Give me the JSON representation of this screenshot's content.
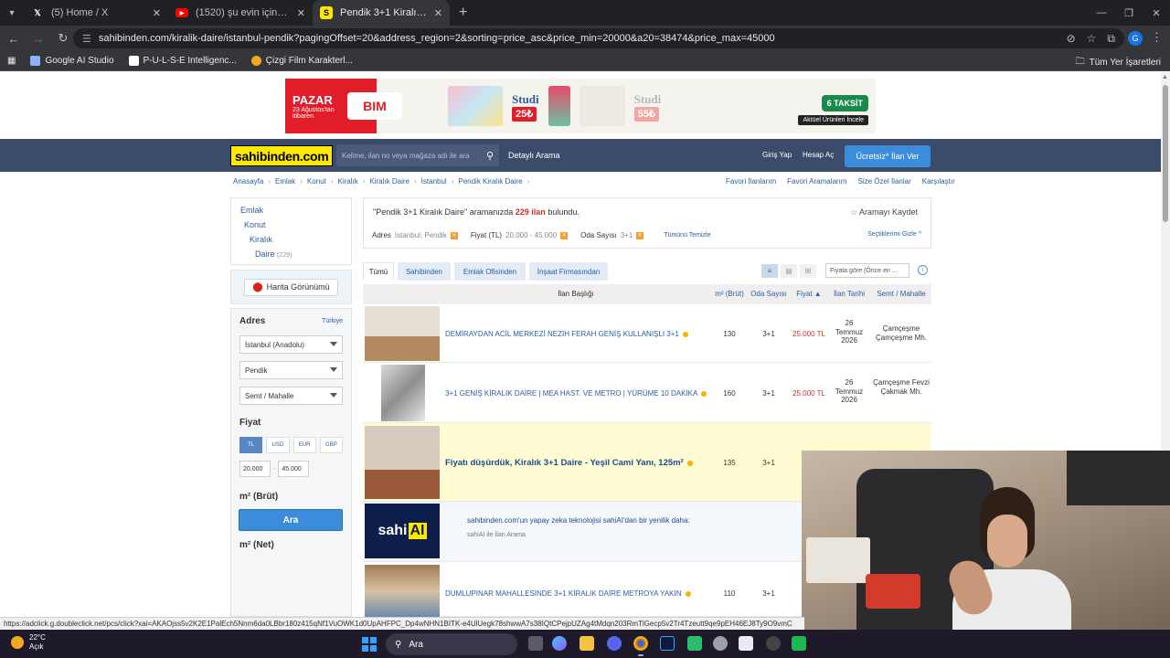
{
  "browser": {
    "tabs": [
      {
        "title": "(5) Home / X",
        "icon": "x-logo-icon",
        "active": false
      },
      {
        "title": "(1520) şu evin içinden merdiven",
        "icon": "youtube-icon",
        "active": false
      },
      {
        "title": "Pendik 3+1 Kiralık Daire Fiyatla",
        "icon": "sahibinden-favicon",
        "active": true
      }
    ],
    "url": "sahibinden.com/kiralik-daire/istanbul-pendik?pagingOffset=20&address_region=2&sorting=price_asc&price_min=20000&a20=38474&price_max=45000",
    "profile_initial": "G",
    "bookmarks": [
      "Google AI Studio",
      "P-U-L-S-E Intelligenc...",
      "Çizgi Film Karakterl..."
    ],
    "bookmarks_right": "Tüm Yer İşaretleri"
  },
  "ad": {
    "day": "PAZAR",
    "date": "23 Ağustos'tan itibaren",
    "brand": "BIM",
    "product1": "Studi",
    "price1": "25₺",
    "product2": "Studi",
    "price2": "55₺",
    "installment": "6 TAKSİT",
    "cta": "Aktüel Ürünleri İncele"
  },
  "header": {
    "logo": "sahibinden.com",
    "search_placeholder": "Kelime, ilan no veya mağaza adı ile ara",
    "detailed_search": "Detaylı Arama",
    "login": "Giriş Yap",
    "register": "Hesap Aç",
    "post_ad": "Ücretsiz* İlan Ver"
  },
  "breadcrumb": [
    "Anasayfa",
    "Emlak",
    "Konut",
    "Kiralık",
    "Kiralık Daire",
    "İstanbul",
    "Pendik Kiralık Daire"
  ],
  "breadcrumb_right": [
    "Favori İlanlarım",
    "Favori Aramalarım",
    "Size Özel İlanlar",
    "Karşılaştır"
  ],
  "sidebar": {
    "categories": [
      {
        "label": "Emlak",
        "count": ""
      },
      {
        "label": "Konut",
        "count": ""
      },
      {
        "label": "Kiralık",
        "count": ""
      },
      {
        "label": "Daire",
        "count": "(229)"
      }
    ],
    "map_button": "Harita Görünümü",
    "address_title": "Adres",
    "address_country": "Türkiye",
    "city": "İstanbul (Anadolu)",
    "district": "Pendik",
    "neighborhood": "Semt / Mahalle",
    "price_title": "Fiyat",
    "currencies": [
      "TL",
      "USD",
      "EUR",
      "GBP"
    ],
    "price_min": "20.000",
    "price_max": "45.000",
    "m2_title": "m² (Brüt)",
    "m2_min_placeholder": "min",
    "m2_max_placeholder": "max",
    "m2_net_title": "m² (Net)",
    "search_button": "Ara"
  },
  "summary": {
    "query": "\"Pendik 3+1 Kiralık Daire\"",
    "text_mid": "aramanızda",
    "count": "229 ilan",
    "text_end": "bulundu.",
    "save_search": "Aramayı Kaydet",
    "filters": [
      {
        "label": "Adres",
        "value": "İstanbul, Pendik"
      },
      {
        "label": "Fiyat (TL)",
        "value": "20.000 - 45.000"
      },
      {
        "label": "Oda Sayısı",
        "value": "3+1"
      }
    ],
    "clear_all": "Tümünü Temizle",
    "hide_selected": "Seçtiklerimi Gizle"
  },
  "result_tabs": [
    "Tümü",
    "Sahibinden",
    "Emlak Ofisinden",
    "İnşaat Firmasından"
  ],
  "sort_label": "Fiyata göre (Önce en ...",
  "table_headers": {
    "title": "İlan Başlığı",
    "m2": "m² (Brüt)",
    "rooms": "Oda Sayısı",
    "price": "Fiyat ▲",
    "date": "İlan Tarihi",
    "location": "Semt / Mahalle"
  },
  "listings": [
    {
      "title": "DEMİRAYDAN ACİL MERKEZİ NEZİH FERAH GENİŞ KULLANIŞLI 3+1",
      "m2": "130",
      "rooms": "3+1",
      "price": "25.000 TL",
      "date": "26 Temmuz 2026",
      "location": "Çamçeşme Çamçeşme Mh."
    },
    {
      "title": "3+1 GENİŞ KİRALIK DAİRE | MEA HAST. VE METRO | YÜRÜME 10 DAKİKA",
      "m2": "160",
      "rooms": "3+1",
      "price": "25.000 TL",
      "date": "26 Temmuz 2026",
      "location": "Çamçeşme Fevzi Çakmak Mh."
    },
    {
      "title": "Fiyatı düşürdük, Kiralık 3+1 Daire - Yeşil Cami Yanı, 125m²",
      "m2": "135",
      "rooms": "3+1",
      "price": "25.",
      "date": "",
      "location": ""
    },
    {
      "title": "DUMLUPINAR MAHALLESİNDE 3+1 KİRALIK DAİRE METROYA YAKIN",
      "m2": "110",
      "rooms": "3+1",
      "price": "25.",
      "date": "",
      "location": ""
    }
  ],
  "sahi_promo": {
    "logo_text": "sahi",
    "logo_ai": "AI",
    "title": "sahibinden.com'un yapay zeka teknolojisi sahiAI'dan bir yenilik daha:",
    "subtitle": "sahiAI ile İlan Arama"
  },
  "status_url": "https://adclick.g.doubleclick.net/pcs/click?xai=AKAOjss5v2K2E1PalEch5Nnm6da0LBbr180z415qNf1VuOWK1d0UpAHFPC_Dp4wNHN1BITK-e4UlUegk78shwwA7s38IQtCPejpUZAg4tMdqn203RmTlGecp5v2Tr4Tzeutt9qe9pEH46EJ8Ty9O9vmC",
  "taskbar": {
    "temperature": "22°C",
    "weather": "Açık",
    "search": "Ara"
  }
}
